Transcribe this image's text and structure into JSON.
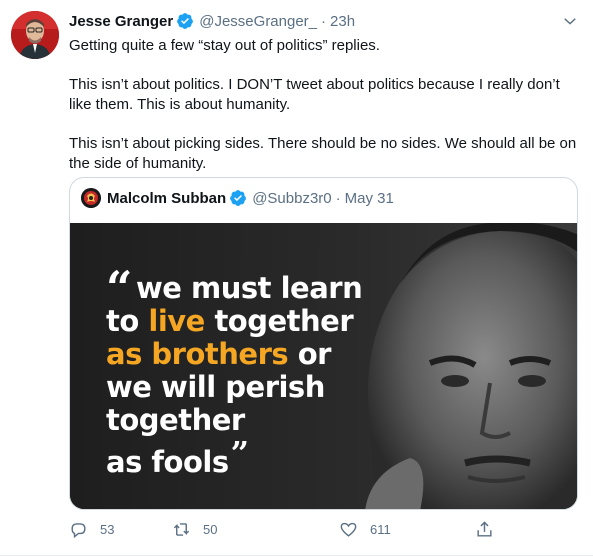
{
  "tweet": {
    "author_name": "Jesse Granger",
    "author_handle": "@JesseGranger_",
    "separator": "·",
    "time": "23h",
    "paragraphs": [
      "Getting quite a few “stay out of politics” replies.",
      "This isn’t about politics. I DON’T tweet about politics because I really don’t like them. This is about humanity.",
      "This isn’t about picking sides. There should be no sides. We should all be on the side of humanity."
    ]
  },
  "quoted": {
    "author_name": "Malcolm Subban",
    "author_handle": "@Subbz3r0",
    "separator": "·",
    "date": "May 31",
    "image_text": {
      "open_quote": "“",
      "line1": "we must learn",
      "line2_a": "to ",
      "line2_b": "live",
      "line2_c": " together",
      "line3_a": "as brothers",
      "line3_b": " or",
      "line4": "we will perish",
      "line5": "together",
      "line6": "as fools",
      "close_quote": "”"
    }
  },
  "actions": {
    "reply_count": "53",
    "retweet_count": "50",
    "like_count": "611"
  },
  "colors": {
    "verified": "#1da1f2",
    "muted": "#5b7083",
    "accent_orange": "#f5a623",
    "avatar_bg": "#c62828"
  },
  "icons": [
    "verified-badge-icon",
    "chevron-down-icon",
    "reply-icon",
    "retweet-icon",
    "like-icon",
    "share-icon"
  ]
}
